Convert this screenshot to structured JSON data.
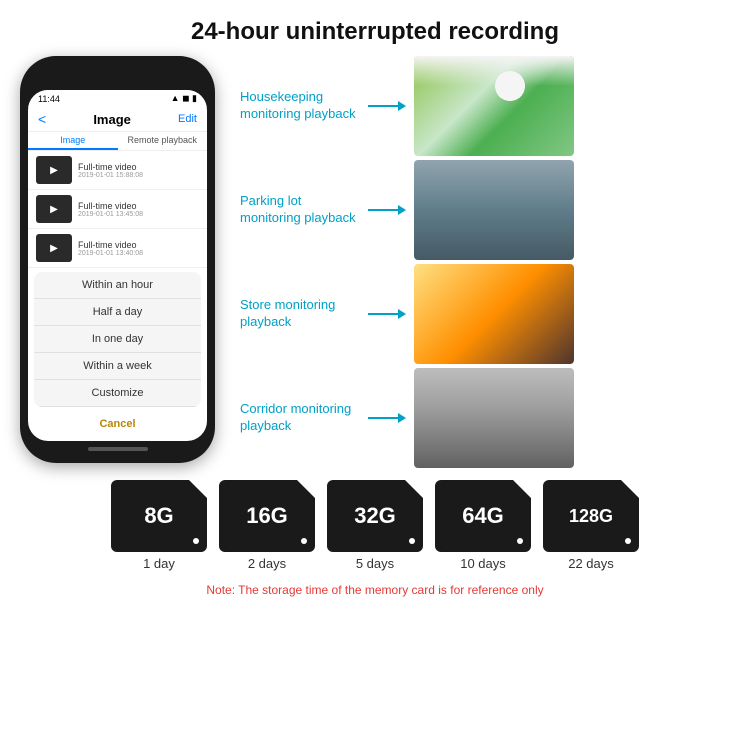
{
  "header": {
    "title": "24-hour uninterrupted recording"
  },
  "phone": {
    "status_time": "11:44",
    "nav_back": "<",
    "nav_title": "Image",
    "nav_edit": "Edit",
    "tab_image": "Image",
    "tab_remote": "Remote playback",
    "videos": [
      {
        "label": "Full-time video",
        "date": "2019-01-01 15:88:08"
      },
      {
        "label": "Full-time video",
        "date": "2019-01-01 13:45:08"
      },
      {
        "label": "Full-time video",
        "date": "2019-01-01 13:40:08"
      }
    ],
    "dropdown": {
      "items": [
        "Within an hour",
        "Half a day",
        "In one day",
        "Within a week",
        "Customize"
      ],
      "cancel": "Cancel"
    }
  },
  "monitoring": [
    {
      "label": "Housekeeping\nmonitoring playback",
      "img_class": "img-housekeeping"
    },
    {
      "label": "Parking lot\nmonitoring playback",
      "img_class": "img-parking"
    },
    {
      "label": "Store monitoring\nplayback",
      "img_class": "img-store"
    },
    {
      "label": "Corridor monitoring\nplayback",
      "img_class": "img-corridor"
    }
  ],
  "sd_cards": [
    {
      "size": "8G",
      "days": "1 day"
    },
    {
      "size": "16G",
      "days": "2 days"
    },
    {
      "size": "32G",
      "days": "5 days"
    },
    {
      "size": "64G",
      "days": "10 days"
    },
    {
      "size": "128G",
      "days": "22 days"
    }
  ],
  "note": "Note: The storage time of the memory card is for reference only"
}
